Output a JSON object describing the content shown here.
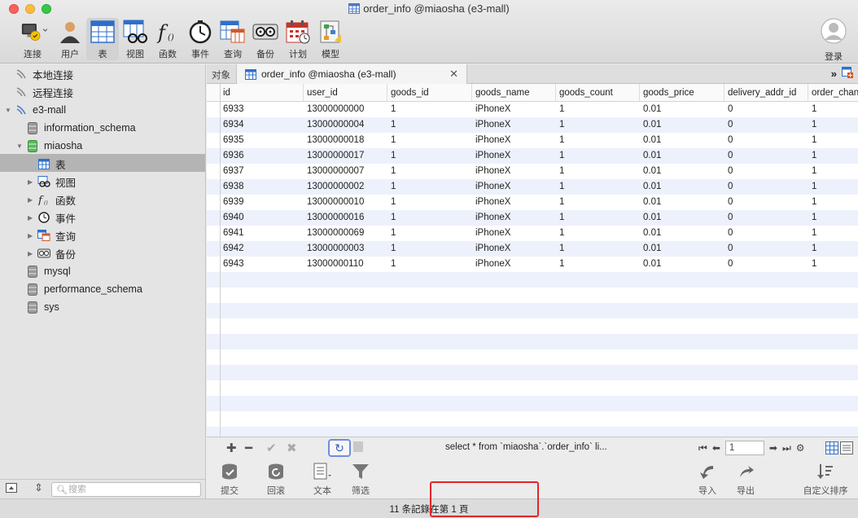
{
  "window": {
    "title": "order_info @miaosha (e3-mall)"
  },
  "toolbar": {
    "items": [
      {
        "label": "连接",
        "icon": "connection-icon"
      },
      {
        "label": "用户",
        "icon": "user-icon"
      },
      {
        "label": "表",
        "icon": "table-icon"
      },
      {
        "label": "视图",
        "icon": "view-icon"
      },
      {
        "label": "函数",
        "icon": "function-icon"
      },
      {
        "label": "事件",
        "icon": "event-icon"
      },
      {
        "label": "查询",
        "icon": "query-icon"
      },
      {
        "label": "备份",
        "icon": "backup-icon"
      },
      {
        "label": "计划",
        "icon": "schedule-icon"
      },
      {
        "label": "模型",
        "icon": "model-icon"
      }
    ],
    "login_label": "登录"
  },
  "sidebar": {
    "items": [
      {
        "label": "本地连接"
      },
      {
        "label": "远程连接"
      },
      {
        "label": "e3-mall"
      },
      {
        "label": "information_schema"
      },
      {
        "label": "miaosha"
      },
      {
        "label": "表"
      },
      {
        "label": "视图"
      },
      {
        "label": "函数"
      },
      {
        "label": "事件"
      },
      {
        "label": "查询"
      },
      {
        "label": "备份"
      },
      {
        "label": "mysql"
      },
      {
        "label": "performance_schema"
      },
      {
        "label": "sys"
      }
    ],
    "search_placeholder": "搜索"
  },
  "tabs": {
    "objects_label": "对象",
    "active_label": "order_info @miaosha (e3-mall)"
  },
  "grid": {
    "columns": [
      "id",
      "user_id",
      "goods_id",
      "goods_name",
      "goods_count",
      "goods_price",
      "delivery_addr_id",
      "order_chan"
    ],
    "rows": [
      [
        "6933",
        "13000000000",
        "1",
        "iPhoneX",
        "1",
        "0.01",
        "0",
        "1"
      ],
      [
        "6934",
        "13000000004",
        "1",
        "iPhoneX",
        "1",
        "0.01",
        "0",
        "1"
      ],
      [
        "6935",
        "13000000018",
        "1",
        "iPhoneX",
        "1",
        "0.01",
        "0",
        "1"
      ],
      [
        "6936",
        "13000000017",
        "1",
        "iPhoneX",
        "1",
        "0.01",
        "0",
        "1"
      ],
      [
        "6937",
        "13000000007",
        "1",
        "iPhoneX",
        "1",
        "0.01",
        "0",
        "1"
      ],
      [
        "6938",
        "13000000002",
        "1",
        "iPhoneX",
        "1",
        "0.01",
        "0",
        "1"
      ],
      [
        "6939",
        "13000000010",
        "1",
        "iPhoneX",
        "1",
        "0.01",
        "0",
        "1"
      ],
      [
        "6940",
        "13000000016",
        "1",
        "iPhoneX",
        "1",
        "0.01",
        "0",
        "1"
      ],
      [
        "6941",
        "13000000069",
        "1",
        "iPhoneX",
        "1",
        "0.01",
        "0",
        "1"
      ],
      [
        "6942",
        "13000000003",
        "1",
        "iPhoneX",
        "1",
        "0.01",
        "0",
        "1"
      ],
      [
        "6943",
        "13000000110",
        "1",
        "iPhoneX",
        "1",
        "0.01",
        "0",
        "1"
      ]
    ]
  },
  "gridbar": {
    "sql_text": "select * from `miaosha`.`order_info`  li...",
    "page_value": "1"
  },
  "actions": {
    "commit": "提交",
    "rollback": "回滚",
    "text": "文本",
    "filter": "筛选",
    "import": "导入",
    "export": "导出",
    "custom_sort": "自定义排序"
  },
  "status": {
    "text": "11 条記錄在第 1 頁"
  },
  "colors": {
    "row_alt": "#edf1fb",
    "highlight_red": "#e0262b",
    "refresh_border": "#6d8fe0"
  }
}
